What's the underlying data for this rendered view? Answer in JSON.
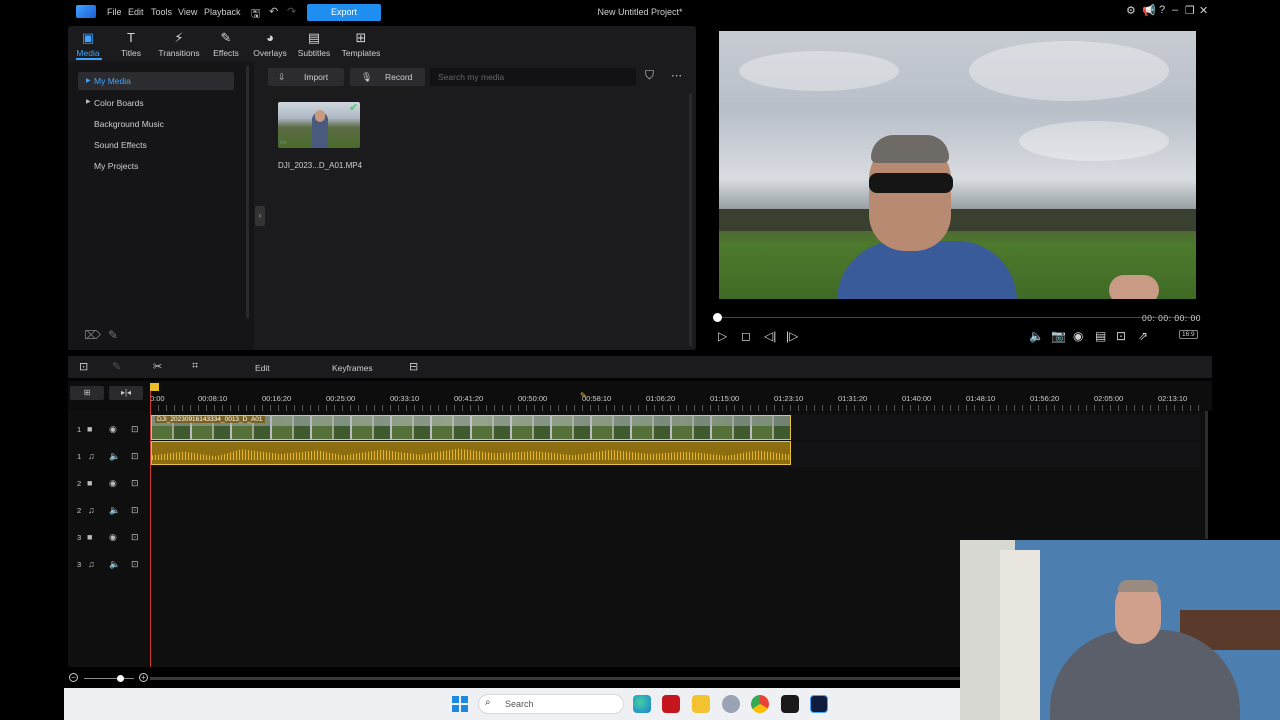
{
  "menu": {
    "items": [
      "File",
      "Edit",
      "Tools",
      "View",
      "Playback"
    ],
    "export_label": "Export",
    "project_title": "New Untitled Project*"
  },
  "tabs": [
    {
      "label": "Media",
      "icon": "media-icon"
    },
    {
      "label": "Titles",
      "icon": "titles-icon"
    },
    {
      "label": "Transitions",
      "icon": "transitions-icon"
    },
    {
      "label": "Effects",
      "icon": "effects-icon"
    },
    {
      "label": "Overlays",
      "icon": "overlays-icon"
    },
    {
      "label": "Subtitles",
      "icon": "subtitles-icon"
    },
    {
      "label": "Templates",
      "icon": "templates-icon"
    }
  ],
  "sidebar": {
    "items": [
      "My Media",
      "Color Boards",
      "Background Music",
      "Sound Effects",
      "My Projects"
    ]
  },
  "library": {
    "import_label": "Import",
    "record_label": "Record",
    "search_placeholder": "Search my media",
    "media_item": "DJI_2023...D_A01.MP4"
  },
  "preview": {
    "timecode": "00: 00: 00: 00",
    "aspect_ratio": "16:9"
  },
  "timeline_toolbar": {
    "edit_label": "Edit",
    "keyframes_label": "Keyframes"
  },
  "ruler": {
    "labels": [
      "0:00",
      "00:08:10",
      "00:16:20",
      "00:25:00",
      "00:33:10",
      "00:41:20",
      "00:50:00",
      "00:58:10",
      "01:06:20",
      "01:15:00",
      "01:23:10",
      "01:31:20",
      "01:40:00",
      "01:48:10",
      "01:56:20",
      "02:05:00",
      "02:13:10"
    ]
  },
  "tracks": [
    {
      "num": "1",
      "kind": "video"
    },
    {
      "num": "1",
      "kind": "audio"
    },
    {
      "num": "2",
      "kind": "video"
    },
    {
      "num": "2",
      "kind": "audio"
    },
    {
      "num": "3",
      "kind": "video"
    },
    {
      "num": "3",
      "kind": "audio"
    }
  ],
  "clip": {
    "name": "DJI_20230916143334_0013_D_A01"
  },
  "taskbar": {
    "search_label": "Search"
  },
  "colors": {
    "accent": "#1f8ef1",
    "clip_border": "#e8c24a",
    "playhead": "#d23a3a"
  }
}
